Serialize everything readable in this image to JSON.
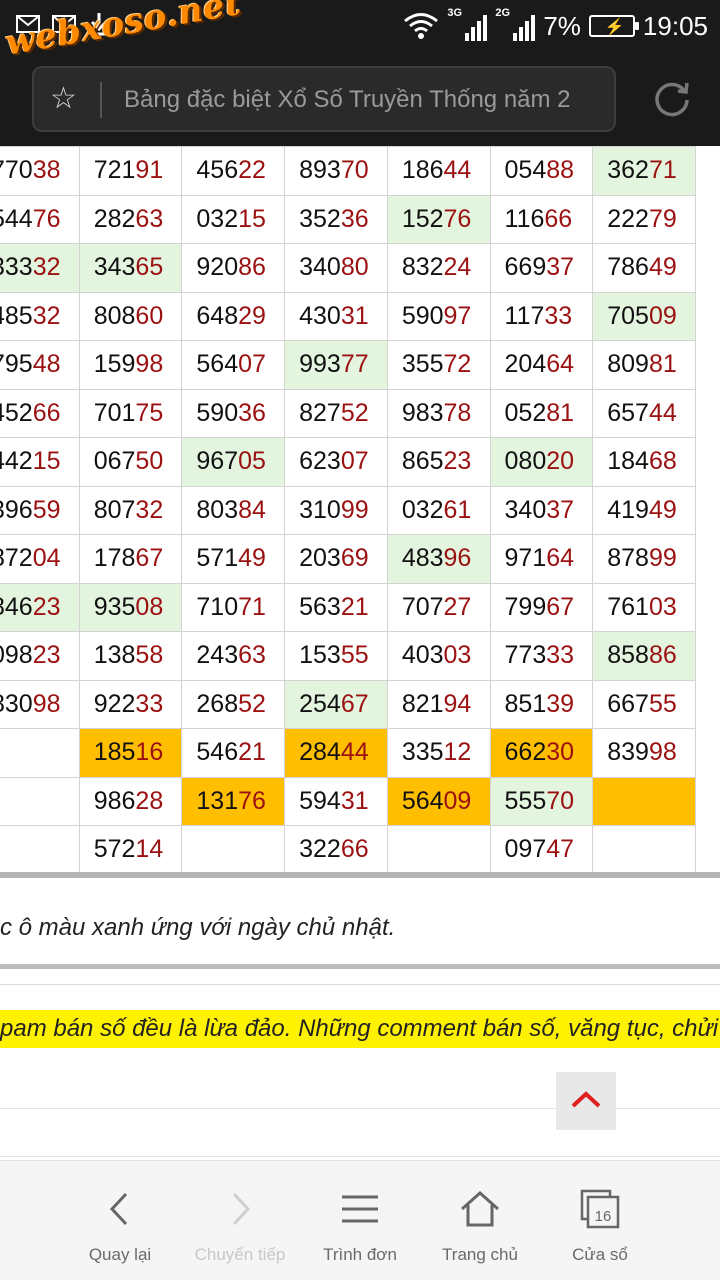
{
  "status_bar": {
    "net1": "3G",
    "net2": "2G",
    "battery": "7%",
    "time": "19:05",
    "icons": [
      "gmail-icon",
      "gmail-icon",
      "download-icon",
      "wifi-icon",
      "signal-icon",
      "battery-charging-icon"
    ]
  },
  "browser": {
    "url_text": "Bảng đặc biệt Xổ Số Truyền Thống năm 2",
    "watermark": "webxoso.net"
  },
  "table": {
    "rows": [
      [
        "77038",
        "72191",
        "45622",
        "89370",
        "18644",
        "05488",
        "36271"
      ],
      [
        "54476",
        "28263",
        "03215",
        "35236",
        "15276",
        "11666",
        "22279"
      ],
      [
        "33332",
        "34365",
        "92086",
        "34080",
        "83224",
        "66937",
        "78649"
      ],
      [
        "48532",
        "80860",
        "64829",
        "43031",
        "59097",
        "11733",
        "70509"
      ],
      [
        "79548",
        "15998",
        "56407",
        "99377",
        "35572",
        "20464",
        "80981"
      ],
      [
        "45266",
        "70175",
        "59036",
        "82752",
        "98378",
        "05281",
        "65744"
      ],
      [
        "44215",
        "06750",
        "96705",
        "62307",
        "86523",
        "08020",
        "18468"
      ],
      [
        "39659",
        "80732",
        "80384",
        "31099",
        "03261",
        "34037",
        "41949"
      ],
      [
        "87204",
        "17867",
        "57149",
        "20369",
        "48396",
        "97164",
        "87899"
      ],
      [
        "84623",
        "93508",
        "71071",
        "56321",
        "70727",
        "79967",
        "76103"
      ],
      [
        "09823",
        "13858",
        "24363",
        "15355",
        "40303",
        "77333",
        "85886"
      ],
      [
        "83098",
        "92233",
        "26852",
        "25467",
        "82194",
        "85139",
        "66755"
      ],
      [
        "",
        "18516",
        "54621",
        "28444",
        "33512",
        "66230",
        "83998"
      ],
      [
        "",
        "98628",
        "13176",
        "59431",
        "56409",
        "55570",
        ""
      ],
      [
        "",
        "57214",
        "",
        "32266",
        "",
        "09747",
        ""
      ]
    ],
    "highlight": [
      [
        "",
        "",
        "",
        "",
        "",
        "",
        "g"
      ],
      [
        "",
        "",
        "",
        "",
        "g",
        "",
        ""
      ],
      [
        "g",
        "g",
        "",
        "",
        "",
        "",
        ""
      ],
      [
        "",
        "",
        "",
        "",
        "",
        "",
        "g"
      ],
      [
        "",
        "",
        "",
        "g",
        "",
        "",
        ""
      ],
      [
        "",
        "",
        "",
        "",
        "",
        "",
        ""
      ],
      [
        "",
        "",
        "g",
        "",
        "",
        "g",
        ""
      ],
      [
        "",
        "",
        "",
        "",
        "",
        "",
        ""
      ],
      [
        "",
        "",
        "",
        "",
        "g",
        "",
        ""
      ],
      [
        "g",
        "g",
        "",
        "",
        "",
        "",
        ""
      ],
      [
        "",
        "",
        "",
        "",
        "",
        "",
        "g"
      ],
      [
        "",
        "",
        "",
        "g",
        "",
        "",
        ""
      ],
      [
        "",
        "o",
        "",
        "o",
        "",
        "o",
        ""
      ],
      [
        "",
        "",
        "o",
        "",
        "o",
        "g",
        "o"
      ],
      [
        "",
        "",
        "",
        "",
        "",
        "",
        ""
      ]
    ],
    "colors": {
      "green": "#e3f4df",
      "orange": "#ffbe00",
      "tail": "#9b1111"
    }
  },
  "note": "c ô màu xanh ứng với ngày chủ nhật.",
  "warning": "pam bán số đều là lừa đảo. Những comment bán số, văng tục, chửi bậ",
  "bottom_nav": [
    {
      "label": "Quay lại",
      "icon": "back-chevron-icon",
      "enabled": true
    },
    {
      "label": "Chuyển tiếp",
      "icon": "forward-chevron-icon",
      "enabled": false
    },
    {
      "label": "Trình đơn",
      "icon": "menu-icon",
      "enabled": true
    },
    {
      "label": "Trang chủ",
      "icon": "home-icon",
      "enabled": true
    },
    {
      "label": "Cửa sổ",
      "icon": "tabs-icon",
      "enabled": true,
      "badge": "16"
    }
  ]
}
